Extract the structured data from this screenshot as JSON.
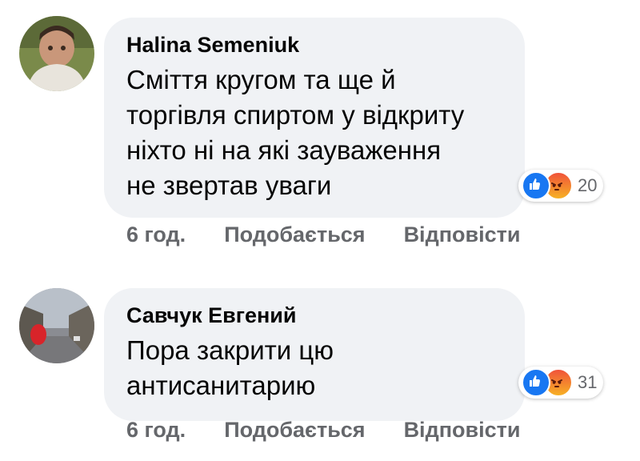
{
  "comments": [
    {
      "author": "Halina Semeniuk",
      "lines": [
        "Сміття кругом та ще й",
        "торгівля спиртом у відкриту",
        "ніхто ні на які зауваження",
        "не звертав уваги"
      ],
      "reaction_icons": [
        "like-icon",
        "angry-icon"
      ],
      "reaction_count": "20",
      "time": "6 год.",
      "like_label": "Подобається",
      "reply_label": "Відповісти"
    },
    {
      "author": "Савчук Евгений",
      "lines": [
        "Пора закрити цю",
        "антисанитарию"
      ],
      "reaction_icons": [
        "like-icon",
        "angry-icon"
      ],
      "reaction_count": "31",
      "time": "6 год.",
      "like_label": "Подобається",
      "reply_label": "Відповісти"
    }
  ],
  "colors": {
    "bubble": "#f0f2f5",
    "text": "#050505",
    "meta": "#65676b",
    "like": "#1877f2",
    "angry": "#f0533a"
  }
}
